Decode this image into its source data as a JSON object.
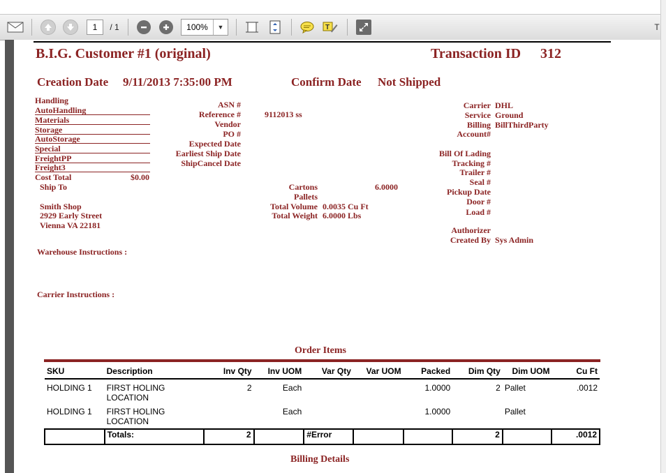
{
  "toolbar": {
    "page_current": "1",
    "page_total": "/ 1",
    "zoom": "100%",
    "overflow": "T"
  },
  "header": {
    "customer": "B.I.G. Customer #1 (original)",
    "transaction_label": "Transaction ID",
    "transaction_id": "312",
    "creation_label": "Creation Date",
    "creation_value": "9/11/2013 7:35:00 PM",
    "confirm_label": "Confirm Date",
    "confirm_value": "Not Shipped"
  },
  "charges": [
    "Handling",
    "AutoHandling",
    "Materials",
    "Storage",
    "AutoStorage",
    "Special",
    "FreightPP",
    "Freight3"
  ],
  "cost_total": {
    "label": "Cost Total",
    "value": "$0.00"
  },
  "ship_to": {
    "label": "Ship To",
    "name": "Smith Shop",
    "street": "2929 Early Street",
    "city": "Vienna  VA  22181"
  },
  "middle_labels": {
    "asn": "ASN #",
    "reference": "Reference #",
    "vendor": "Vendor",
    "po": "PO #",
    "expected": "Expected Date",
    "earliest": "Earliest Ship Date",
    "cancel": "ShipCancel Date"
  },
  "reference_value": "9112013 ss",
  "measures": {
    "cartons_label": "Cartons",
    "cartons_value": "6.0000",
    "pallets_label": "Pallets",
    "volume_label": "Total Volume",
    "volume_value": "0.0035 Cu Ft",
    "weight_label": "Total Weight",
    "weight_value": "6.0000 Lbs"
  },
  "right": {
    "carrier_label": "Carrier",
    "carrier_value": "DHL",
    "service_label": "Service",
    "service_value": "Ground",
    "billing_label": "Billing",
    "billing_value": "BillThirdParty",
    "account_label": "Account#",
    "bol_label": "Bill Of Lading",
    "tracking_label": "Tracking #",
    "trailer_label": "Trailer #",
    "seal_label": "Seal #",
    "pickup_label": "Pickup Date",
    "door_label": "Door #",
    "load_label": "Load #",
    "authorizer_label": "Authorizer",
    "created_label": "Created By",
    "created_value": "Sys Admin"
  },
  "warehouse_instructions": "Warehouse Instructions :",
  "carrier_instructions": "Carrier Instructions :",
  "order_items": {
    "title": "Order Items",
    "columns": [
      "SKU",
      "Description",
      "Inv Qty",
      "Inv UOM",
      "Var Qty",
      "Var UOM",
      "Packed",
      "Dim Qty",
      "Dim UOM",
      "Cu Ft"
    ],
    "rows": [
      {
        "sku": "HOLDING 1",
        "desc1": "FIRST HOLING",
        "desc2": "LOCATION",
        "inv_qty": "2",
        "inv_uom": "Each",
        "var_qty": "",
        "var_uom": "",
        "packed": "1.0000",
        "dim_qty": "2",
        "dim_uom": "Pallet",
        "cuft": ".0012"
      },
      {
        "sku": "HOLDING 1",
        "desc1": "FIRST HOLING",
        "desc2": "LOCATION",
        "inv_qty": "",
        "inv_uom": "Each",
        "var_qty": "",
        "var_uom": "",
        "packed": "1.0000",
        "dim_qty": "",
        "dim_uom": "Pallet",
        "cuft": ""
      }
    ],
    "totals": {
      "label": "Totals:",
      "inv_qty": "2",
      "var_qty": "#Error",
      "dim_qty": "2",
      "cuft": ".0012"
    }
  },
  "billing_details": "Billing Details",
  "colors": {
    "accent": "#8b2323",
    "toolbar": "#e6e6e6"
  }
}
